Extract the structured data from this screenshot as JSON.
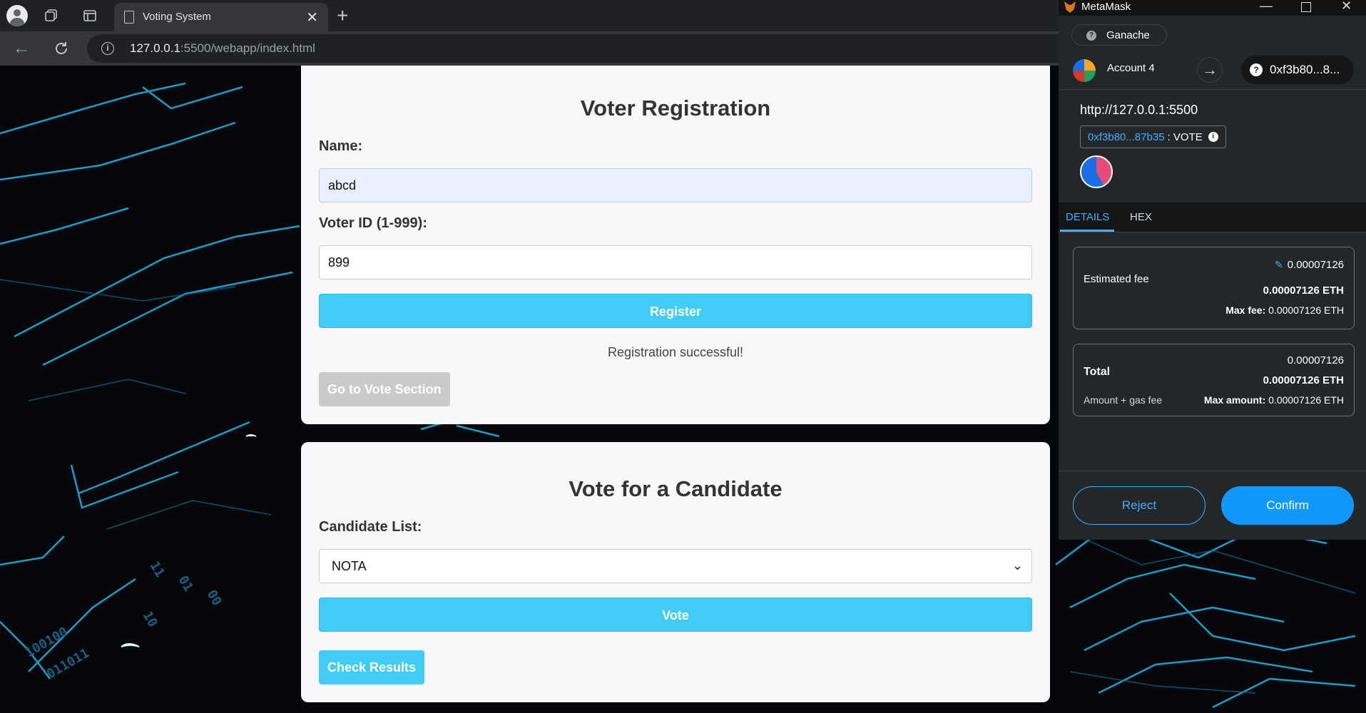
{
  "browser": {
    "tab_title": "Voting System",
    "url_host": "127.0.0.1",
    "url_path": ":5500/webapp/index.html"
  },
  "registration": {
    "title": "Voter Registration",
    "name_label": "Name:",
    "name_value": "abcd",
    "voter_id_label": "Voter ID (1-999):",
    "voter_id_value": "899",
    "register_button": "Register",
    "status_message": "Registration successful!",
    "go_to_vote_button": "Go to Vote Section"
  },
  "vote": {
    "title": "Vote for a Candidate",
    "candidate_list_label": "Candidate List:",
    "selected_candidate": "NOTA",
    "vote_button": "Vote",
    "check_results_button": "Check Results"
  },
  "metamask": {
    "window_title": "MetaMask",
    "network": "Ganache",
    "account_name": "Account 4",
    "to_address": "0xf3b80...8...",
    "origin": "http://127.0.0.1:5500",
    "contract_address": "0xf3b80...87b35",
    "contract_method": ": VOTE",
    "tabs": [
      "DETAILS",
      "HEX"
    ],
    "estimated_fee_label": "Estimated fee",
    "estimated_fee_value": "0.00007126",
    "estimated_fee_eth": "0.00007126 ETH",
    "max_fee_label": "Max fee:",
    "max_fee_value": "0.00007126 ETH",
    "total_label": "Total",
    "total_value": "0.00007126",
    "total_eth": "0.00007126 ETH",
    "amount_gas_label": "Amount + gas fee",
    "max_amount_label": "Max amount:",
    "max_amount_value": "0.00007126 ETH",
    "reject_button": "Reject",
    "confirm_button": "Confirm"
  },
  "colors": {
    "accent": "#41ccf5",
    "metamask_blue": "#1098fc",
    "metamask_bg": "#24272a"
  }
}
